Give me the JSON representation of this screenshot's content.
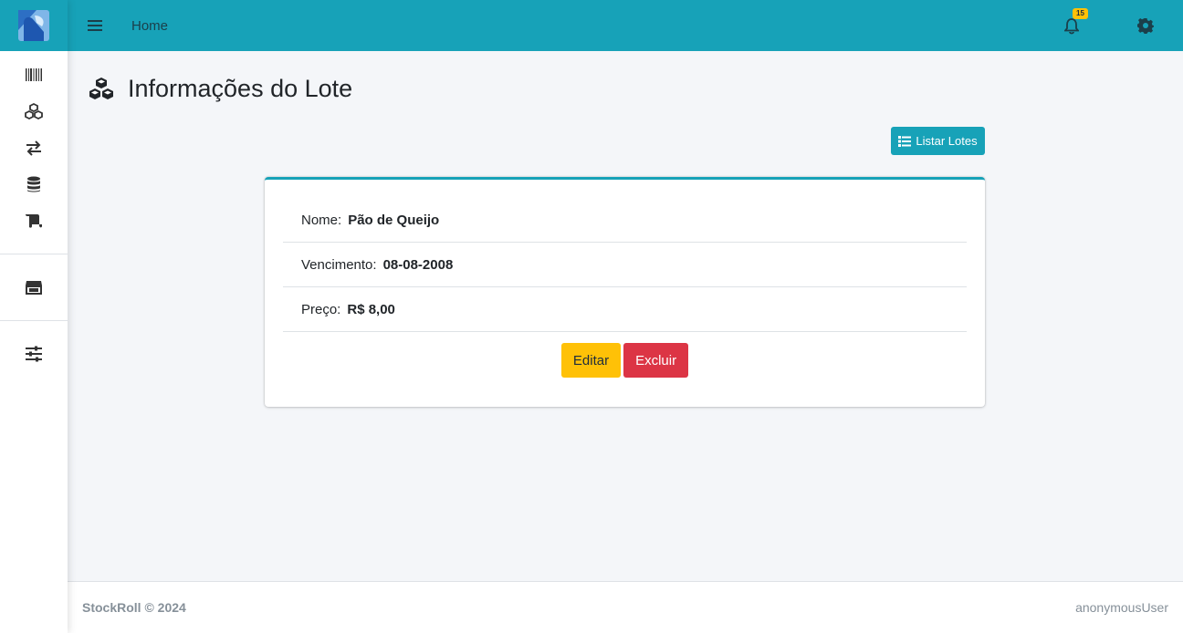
{
  "topbar": {
    "home_label": "Home",
    "notification_count": "15"
  },
  "page": {
    "title": "Informações do Lote",
    "list_button_label": "Listar Lotes"
  },
  "lote": {
    "fields": [
      {
        "label": "Nome:",
        "value": "Pão de Queijo"
      },
      {
        "label": "Vencimento:",
        "value": "08-08-2008"
      },
      {
        "label": "Preço:",
        "value": "R$ 8,00"
      }
    ],
    "edit_label": "Editar",
    "delete_label": "Excluir"
  },
  "footer": {
    "brand": "StockRoll © 2024",
    "user": "anonymousUser"
  },
  "sidebar": {
    "icons": [
      "barcode-icon",
      "cubes-icon",
      "exchange-icon",
      "database-icon",
      "scroll-icon",
      "store-icon",
      "sliders-icon"
    ]
  },
  "colors": {
    "primary": "#17a2b8",
    "warning": "#ffc107",
    "danger": "#dc3545",
    "background": "#f4f6f9"
  }
}
